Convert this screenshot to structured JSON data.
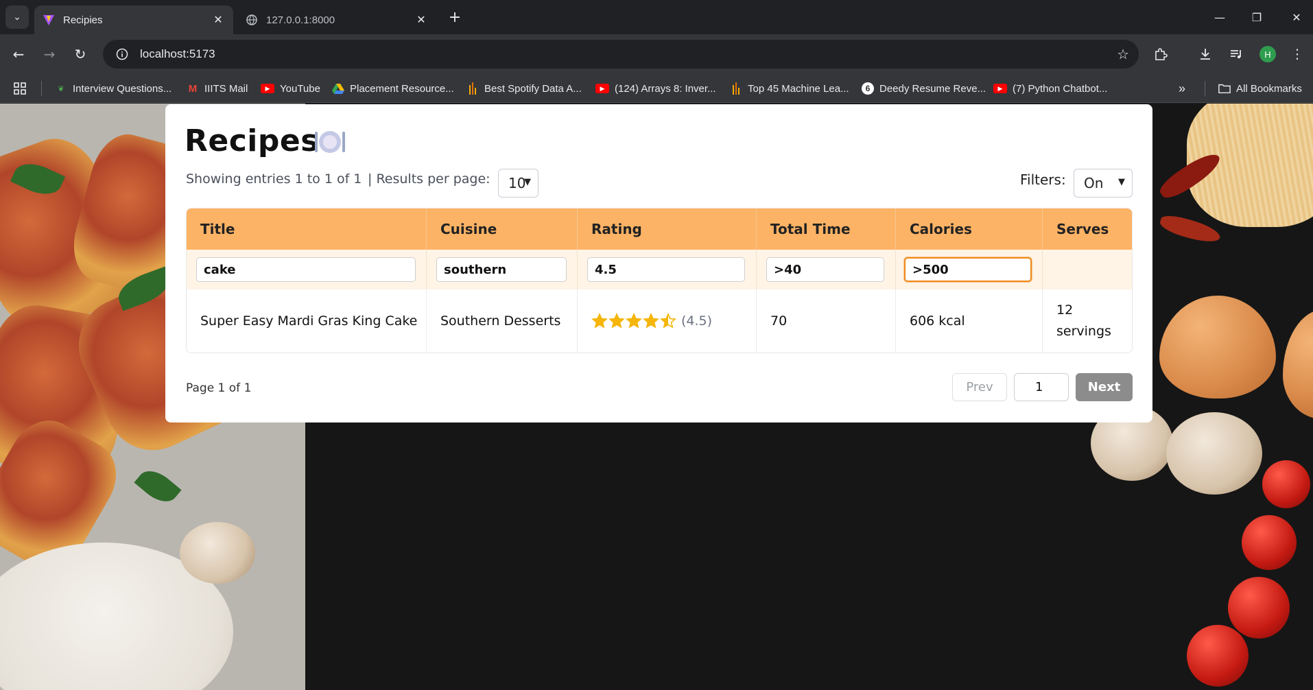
{
  "browser": {
    "tabs": [
      {
        "title": "Recipies",
        "active": true
      },
      {
        "title": "127.0.0.1:8000",
        "active": false
      }
    ],
    "url": "localhost:5173",
    "bookmarks": [
      "Interview Questions...",
      "IIITS Mail",
      "YouTube",
      "Placement Resource...",
      "Best Spotify Data A...",
      "(124) Arrays 8: Inver...",
      "Top 45 Machine Lea...",
      "Deedy Resume Reve...",
      "(7) Python Chatbot..."
    ],
    "all_bookmarks": "All Bookmarks",
    "profile_initial": "H"
  },
  "page": {
    "title": "Recipes",
    "showing": "Showing entries 1 to 1 of 1",
    "results_per_page_label": "| Results per page:",
    "results_per_page_value": "10",
    "filters_label": "Filters:",
    "filters_value": "On"
  },
  "table": {
    "columns": [
      "Title",
      "Cuisine",
      "Rating",
      "Total Time",
      "Calories",
      "Serves"
    ],
    "filters": {
      "title": "cake",
      "cuisine": "southern",
      "rating": "4.5",
      "total_time": ">40",
      "calories": ">500"
    },
    "rows": [
      {
        "title": "Super Easy Mardi Gras King Cake",
        "cuisine": "Southern Desserts",
        "rating": 4.5,
        "rating_text": "(4.5)",
        "total_time": "70",
        "calories": "606 kcal",
        "serves": "12 servings"
      }
    ]
  },
  "pagination": {
    "page_info": "Page 1 of 1",
    "prev_label": "Prev",
    "current_page": "1",
    "next_label": "Next"
  },
  "colors": {
    "header_orange": "#fdb365",
    "filter_row": "#fff4e6",
    "star_yellow": "#f5b50a",
    "next_button": "#8c8c8c",
    "focus_orange": "#f08a1d"
  }
}
